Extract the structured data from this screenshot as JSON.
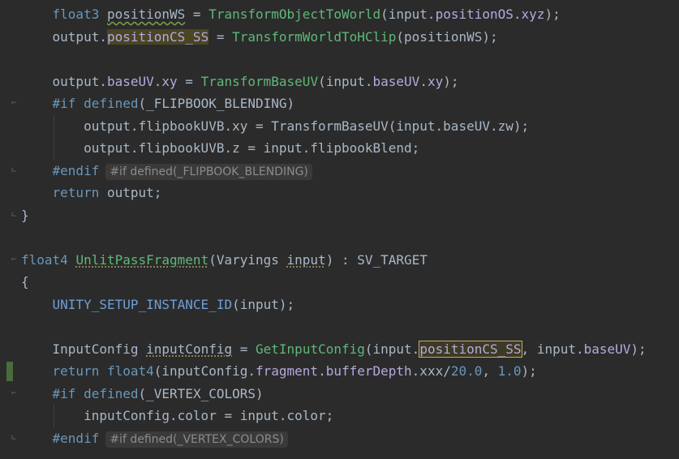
{
  "lines": [
    {
      "id": 1,
      "tokens": [
        [
          "    ",
          "plain"
        ],
        [
          "float3",
          "type"
        ],
        [
          " ",
          "plain"
        ],
        [
          "positionWS",
          "plain squiggle"
        ],
        [
          " = ",
          "plain"
        ],
        [
          "TransformObjectToWorld",
          "fn"
        ],
        [
          "(input.",
          "plain"
        ],
        [
          "positionOS",
          "field"
        ],
        [
          ".",
          "plain"
        ],
        [
          "xyz",
          "field"
        ],
        [
          ");",
          "plain"
        ]
      ]
    },
    {
      "id": 2,
      "tokens": [
        [
          "    ",
          "plain"
        ],
        [
          "output.",
          "plain"
        ],
        [
          "positionCS_SS",
          "field hl-ref"
        ],
        [
          " = ",
          "plain"
        ],
        [
          "TransformWorldToHClip",
          "fn"
        ],
        [
          "(positionWS);",
          "plain"
        ]
      ]
    },
    {
      "id": 3,
      "tokens": []
    },
    {
      "id": 4,
      "tokens": [
        [
          "    ",
          "plain"
        ],
        [
          "output.",
          "plain"
        ],
        [
          "baseUV",
          "field"
        ],
        [
          ".",
          "plain"
        ],
        [
          "xy",
          "field"
        ],
        [
          " = ",
          "plain"
        ],
        [
          "TransformBaseUV",
          "fn"
        ],
        [
          "(input.",
          "plain"
        ],
        [
          "baseUV",
          "field"
        ],
        [
          ".",
          "plain"
        ],
        [
          "xy",
          "field"
        ],
        [
          ");",
          "plain"
        ]
      ]
    },
    {
      "id": 5,
      "tokens": [
        [
          "    ",
          "plain"
        ],
        [
          "#if",
          "kw"
        ],
        [
          " ",
          "plain"
        ],
        [
          "defined",
          "kw"
        ],
        [
          "(_FLIPBOOK_BLENDING)",
          "plain"
        ]
      ]
    },
    {
      "id": 6,
      "tokens": [
        [
          "        ",
          "plain"
        ],
        [
          "output.flipbookUVB.xy = TransformBaseUV(input.baseUV.zw);",
          "plain"
        ]
      ]
    },
    {
      "id": 7,
      "tokens": [
        [
          "        ",
          "plain"
        ],
        [
          "output.flipbookUVB.z = input.flipbookBlend;",
          "plain"
        ]
      ]
    },
    {
      "id": 8,
      "tokens": [
        [
          "    ",
          "plain"
        ],
        [
          "#endif",
          "kw"
        ]
      ],
      "hint": "#if defined(_FLIPBOOK_BLENDING)"
    },
    {
      "id": 9,
      "tokens": [
        [
          "    ",
          "plain"
        ],
        [
          "return",
          "kw"
        ],
        [
          " output;",
          "plain"
        ]
      ]
    },
    {
      "id": 10,
      "tokens": [
        [
          "}",
          "plain"
        ]
      ]
    },
    {
      "id": 11,
      "tokens": []
    },
    {
      "id": 12,
      "tokens": [
        [
          "float4",
          "type"
        ],
        [
          " ",
          "plain"
        ],
        [
          "UnlitPassFragment",
          "fn dotted"
        ],
        [
          "(Varyings ",
          "plain"
        ],
        [
          "input",
          "plain dotted"
        ],
        [
          ") : SV_TARGET",
          "plain"
        ]
      ]
    },
    {
      "id": 13,
      "tokens": [
        [
          "{",
          "plain"
        ]
      ]
    },
    {
      "id": 14,
      "tokens": [
        [
          "    ",
          "plain"
        ],
        [
          "UNITY_SETUP_INSTANCE_ID",
          "macro"
        ],
        [
          "(input);",
          "plain"
        ]
      ]
    },
    {
      "id": 15,
      "tokens": []
    },
    {
      "id": 16,
      "tokens": [
        [
          "    ",
          "plain"
        ],
        [
          "InputConfig",
          "plain"
        ],
        [
          " ",
          "plain"
        ],
        [
          "inputConfig",
          "plain dotted"
        ],
        [
          " = ",
          "plain"
        ],
        [
          "GetInputConfig",
          "fn"
        ],
        [
          "(input.",
          "plain"
        ],
        [
          "positionCS_SS",
          "field hl-box"
        ],
        [
          ", input.",
          "plain"
        ],
        [
          "baseUV",
          "field"
        ],
        [
          ");",
          "plain"
        ]
      ]
    },
    {
      "id": 17,
      "tokens": [
        [
          "    ",
          "plain"
        ],
        [
          "return",
          "kw"
        ],
        [
          " ",
          "plain"
        ],
        [
          "float4",
          "type"
        ],
        [
          "(inputConfig.",
          "plain"
        ],
        [
          "fragment",
          "field"
        ],
        [
          ".",
          "plain"
        ],
        [
          "bufferDepth",
          "field"
        ],
        [
          ".xxx/",
          "plain"
        ],
        [
          "20.0",
          "num"
        ],
        [
          ", ",
          "plain"
        ],
        [
          "1.0",
          "num"
        ],
        [
          ");",
          "plain"
        ]
      ]
    },
    {
      "id": 18,
      "tokens": [
        [
          "    ",
          "plain"
        ],
        [
          "#if",
          "kw"
        ],
        [
          " ",
          "plain"
        ],
        [
          "defined",
          "kw"
        ],
        [
          "(_VERTEX_COLORS)",
          "plain"
        ]
      ]
    },
    {
      "id": 19,
      "tokens": [
        [
          "        ",
          "plain"
        ],
        [
          "inputConfig.color = input.color;",
          "plain"
        ]
      ]
    },
    {
      "id": 20,
      "tokens": [
        [
          "    ",
          "plain"
        ],
        [
          "#endif",
          "kw"
        ]
      ],
      "hint": "#if defined(_VERTEX_COLORS)"
    }
  ],
  "colors": {
    "background": "#2b2b2b",
    "keyword": "#6897bb",
    "function": "#5fb878",
    "field": "#b8a8e0",
    "macro": "#6e9fd8",
    "default_text": "#a9b7c6"
  },
  "icons": [
    "fold-icon",
    "change-marker"
  ]
}
